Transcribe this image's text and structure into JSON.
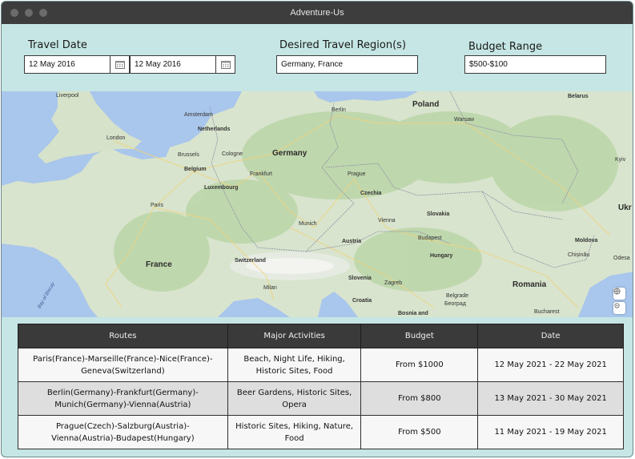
{
  "window": {
    "title": "Adventure-Us"
  },
  "filters": {
    "travel_date_label": "Travel Date",
    "start_date": "12 May 2016",
    "end_date": "12 May 2016",
    "region_label": "Desired Travel Region(s)",
    "region_value": "Germany, France",
    "budget_label": "Budget Range",
    "budget_value": "$500-$100"
  },
  "map": {
    "countries": {
      "poland": "Poland",
      "germany": "Germany",
      "france": "France",
      "romania": "Romania",
      "belarus": "Belarus",
      "ukraine": "Ukr"
    },
    "cities": {
      "liverpool": "Liverpool",
      "amsterdam": "Amsterdam",
      "netherlands": "Netherlands",
      "london": "London",
      "brussels": "Brussels",
      "belgium": "Belgium",
      "cologne": "Cologne",
      "luxembourg": "Luxembourg",
      "frankfurt": "Frankfurt",
      "paris": "Paris",
      "berlin": "Berlin",
      "warsaw": "Warsaw",
      "prague": "Prague",
      "czechia": "Czechia",
      "munich": "Munich",
      "vienna": "Vienna",
      "austria": "Austria",
      "slovakia": "Slovakia",
      "budapest": "Budapest",
      "hungary": "Hungary",
      "switzerland": "Switzerland",
      "milan": "Milan",
      "slovenia": "Slovenia",
      "zagreb": "Zagreb",
      "croatia": "Croatia",
      "moldova": "Moldova",
      "chisinau": "Chișinău",
      "odesa": "Odesa",
      "bucharest": "Bucharest",
      "bosnia": "Bosnia and",
      "belgrade": "Belgrade",
      "kyiv": "Kyiv",
      "belgrade_cyr": "Београд"
    },
    "sea_label": "Bay of Biscay"
  },
  "table": {
    "headers": [
      "Routes",
      "Major Activities",
      "Budget",
      "Date"
    ],
    "rows": [
      {
        "route": "Paris(France)-Marseille(France)-Nice(France)-Geneva(Switzerland)",
        "activities": "Beach, Night Life, Hiking, Historic Sites, Food",
        "budget": "From $1000",
        "date": "12 May 2021 - 22 May 2021"
      },
      {
        "route": "Berlin(Germany)-Frankfurt(Germany)-Munich(Germany)-Vienna(Austria)",
        "activities": "Beer Gardens, Historic Sites, Opera",
        "budget": "From $800",
        "date": "13 May 2021 - 30 May 2021"
      },
      {
        "route": "Prague(Czech)-Salzburg(Austria)-Vienna(Austria)-Budapest(Hungary)",
        "activities": "Historic Sites, Hiking, Nature, Food",
        "budget": "From $500",
        "date": "11 May 2021 - 19 May 2021"
      }
    ]
  }
}
